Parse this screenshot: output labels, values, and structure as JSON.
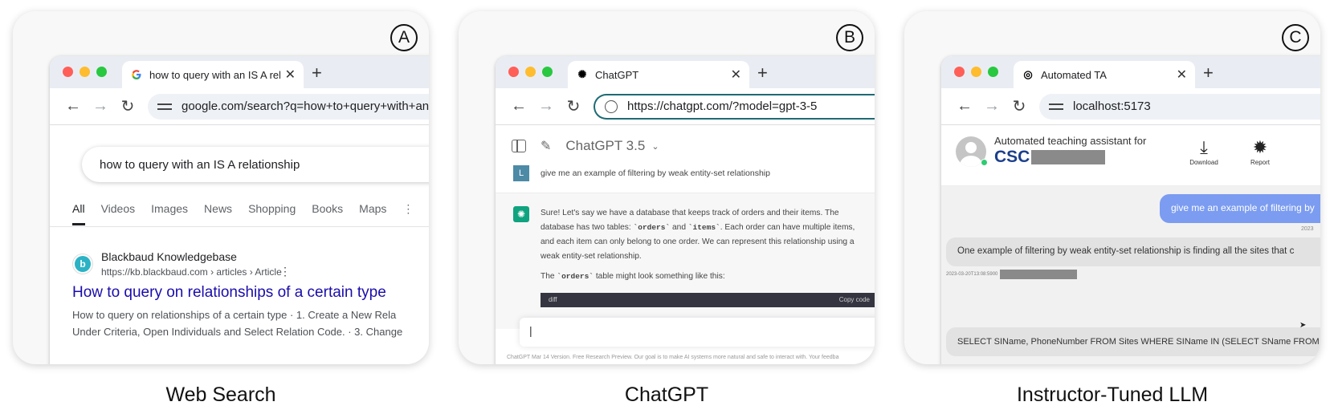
{
  "panels": [
    {
      "marker": "A",
      "caption": "Web Search",
      "tab_title": "how to query with an IS A rela",
      "url": "google.com/search?q=how+to+query+with+an+I",
      "search_query": "how to query with an IS A relationship",
      "search_tabs": [
        "All",
        "Videos",
        "Images",
        "News",
        "Shopping",
        "Books",
        "Maps"
      ],
      "result": {
        "site_name": "Blackbaud Knowledgebase",
        "site_url": "https://kb.blackbaud.com › articles › Article",
        "title": "How to query on relationships of a certain type",
        "snippet_line1": "How to query on relationships of a certain type · 1. Create a New Rela",
        "snippet_line2": "Under Criteria, Open Individuals and Select Relation Code. · 3. Change"
      }
    },
    {
      "marker": "B",
      "caption": "ChatGPT",
      "tab_title": "ChatGPT",
      "url": "https://chatgpt.com/?model=gpt-3-5",
      "model_label": "ChatGPT 3.5",
      "user_initial": "L",
      "user_message": "give me an example of filtering by weak entity-set relationship",
      "reply_part1": "Sure! Let's say we have a database that keeps track of orders and their items. The database has two tables: ",
      "reply_code1": "`orders`",
      "reply_and": " and ",
      "reply_code2": "`items`",
      "reply_part2": ". Each order can have multiple items, and each item can only belong to one order. We can represent this relationship using a weak entity-set relationship.",
      "reply_line2_a": "The ",
      "reply_line2_code": "`orders`",
      "reply_line2_b": " table might look something like this:",
      "code_lang": "diff",
      "code_copy": "Copy code",
      "footer": "ChatGPT Mar 14 Version. Free Research Preview. Our goal is to make AI systems more natural and safe to interact with. Your feedba"
    },
    {
      "marker": "C",
      "caption": "Instructor-Tuned LLM",
      "tab_title": "Automated TA",
      "url": "localhost:5173",
      "subtitle": "Automated teaching assistant for",
      "course_prefix": "CSC",
      "download_label": "Download",
      "report_label": "Report",
      "user_message": "give me an example of filtering by",
      "time1": "2023",
      "bot_message": "One example of filtering by weak entity-set relationship is finding all the sites that c",
      "time2": "2023-03-20T13:08:5900",
      "time3": "202",
      "bot_message2": "SELECT SIName, PhoneNumber FROM Sites WHERE SIName IN (SELECT SName FROM S"
    }
  ]
}
